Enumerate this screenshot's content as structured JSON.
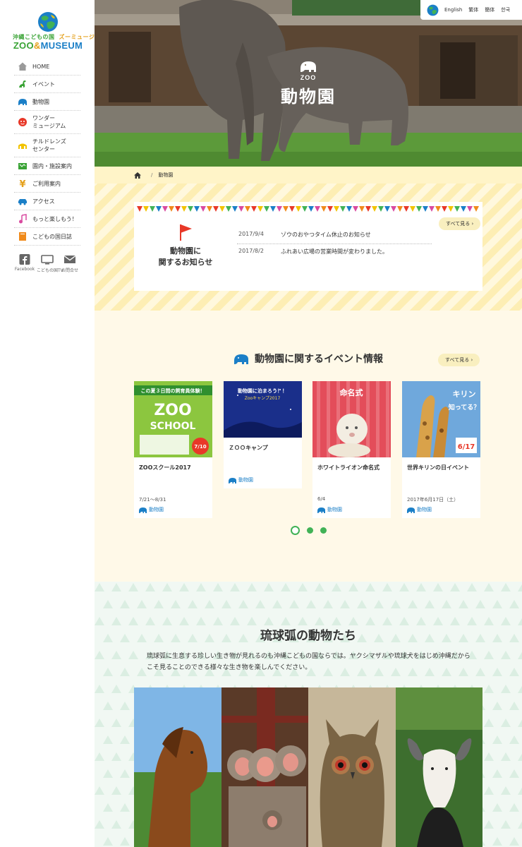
{
  "logo": {
    "sub_ja": "沖縄こどもの国",
    "sub_kata": "ズーミュージアム",
    "zoo": "ZOO",
    "amp": "&",
    "museum": "MUSEUM"
  },
  "sidebar": {
    "items": [
      {
        "label": "HOME",
        "icon": "house-icon"
      },
      {
        "label": "イベント",
        "icon": "dinosaur-icon"
      },
      {
        "label": "動物園",
        "icon": "elephant-icon"
      },
      {
        "label": "ワンダー\nミュージアム",
        "icon": "face-icon"
      },
      {
        "label": "チルドレンズ\nセンター",
        "icon": "building-icon"
      },
      {
        "label": "園内・施設案内",
        "icon": "map-icon"
      },
      {
        "label": "ご利用案内",
        "icon": "yen-icon"
      },
      {
        "label": "アクセス",
        "icon": "car-icon"
      },
      {
        "label": "もっと楽しもう！",
        "icon": "music-note-icon"
      },
      {
        "label": "こどもの国日誌",
        "icon": "notebook-icon"
      }
    ],
    "social": [
      {
        "label": "Facebook",
        "icon": "facebook-icon"
      },
      {
        "label": "こどもの国TV",
        "icon": "tv-icon"
      },
      {
        "label": "お問合せ",
        "icon": "mail-icon"
      }
    ]
  },
  "langbar": {
    "items": [
      "English",
      "繁体",
      "簡体",
      "한국"
    ]
  },
  "hero": {
    "label_en": "ZOO",
    "title": "動物園"
  },
  "breadcrumb": {
    "current": "動物園"
  },
  "notice": {
    "heading_line1": "動物園に",
    "heading_line2": "関するお知らせ",
    "see_all": "すべて見る ›",
    "items": [
      {
        "date": "2017/9/4",
        "text": "ゾウのおやつタイム休止のお知らせ"
      },
      {
        "date": "2017/8/2",
        "text": "ふれあい広場の営業時間が変わりました。"
      }
    ]
  },
  "events": {
    "heading": "動物園に関するイベント情報",
    "see_all": "すべて見る ›",
    "cards": [
      {
        "title": "ZOOスクール2017",
        "date": "7/21〜8/31",
        "category": "動物園"
      },
      {
        "title": "ＺＯＯキャンプ",
        "date": "",
        "category": "動物園"
      },
      {
        "title": "ホワイトライオン命名式",
        "date": "6/4",
        "category": "動物園"
      },
      {
        "title": "世界キリンの日イベント",
        "date": "2017年6月17日（土）",
        "category": "動物園"
      }
    ],
    "card_images": {
      "zoo_school_banner": "この夏３日間の飼育員体験！",
      "zoo_school_z": "ZOO",
      "zoo_school_s": "SCHOOL",
      "zoo_school_date": "7/10",
      "camp_banner": "動物園に泊まろう！！",
      "camp_sub": "Zooキャンプ2017",
      "lion_text": "命名式",
      "giraffe_text_1": "キリン",
      "giraffe_text_2": "知ってる？",
      "giraffe_date": "6/17"
    },
    "pages": 3,
    "active_page": 1
  },
  "animals": {
    "heading": "琉球弧の動物たち",
    "description": "琉球弧に生息する珍しい生き物が見れるのも沖縄こどもの国ならでは。ヤクシマザルや琉球犬をはじめ沖縄だからこそ見ることのできる様々な生き物を楽しんでください。"
  },
  "colors": {
    "green": "#41b256",
    "blue": "#1b7fc7",
    "yellow_bg": "#fff9e8",
    "stripe": "#fdeeb4",
    "red_flag": "#e83828"
  }
}
